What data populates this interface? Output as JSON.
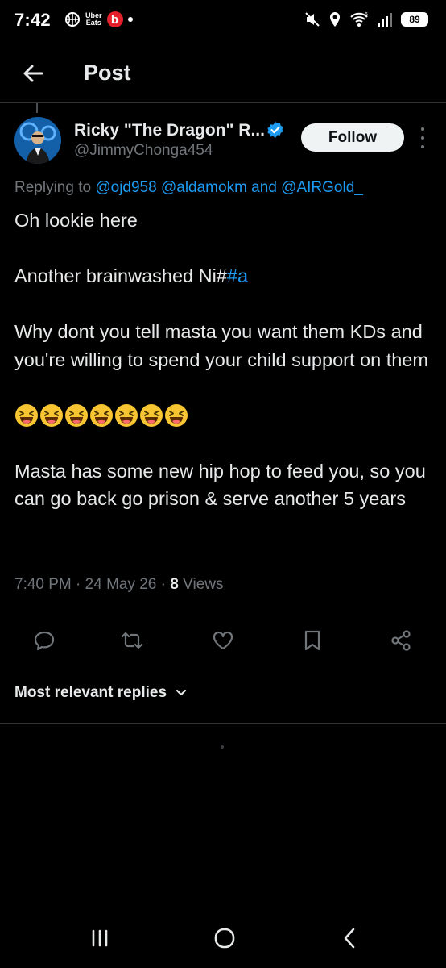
{
  "status_bar": {
    "time": "7:42",
    "uber_line1": "Uber",
    "uber_line2": "Eats",
    "beats": "b",
    "network": "6",
    "battery": "89"
  },
  "header": {
    "title": "Post"
  },
  "author": {
    "name": "Ricky \"The Dragon\" R...",
    "handle": "@JimmyChonga454",
    "follow_label": "Follow"
  },
  "replying": {
    "prefix": "Replying to ",
    "mention1": "@ojd958",
    "mention2": "@aldamokm",
    "and": " and ",
    "mention3": "@AIRGold_"
  },
  "tweet": {
    "line1": "Oh lookie here",
    "line2_text": "Another brainwashed Ni#",
    "line2_hashtag": "#a",
    "line3": "Why dont you tell masta you want them KDs and you're willing to spend your child support on them",
    "emoji_count_label": "😆😆😆😆😆😆😆",
    "line5": "Masta has some new hip hop to feed you, so you can go back go prison & serve another 5 years"
  },
  "meta": {
    "time": "7:40 PM",
    "sep1": " · ",
    "date": "24 May 26",
    "sep2": " · ",
    "views_count": "8",
    "views_label": " Views"
  },
  "replies": {
    "sort_label": "Most relevant replies"
  },
  "colors": {
    "accent": "#1d9bf0",
    "background": "#000000",
    "secondary_text": "#71767b"
  }
}
